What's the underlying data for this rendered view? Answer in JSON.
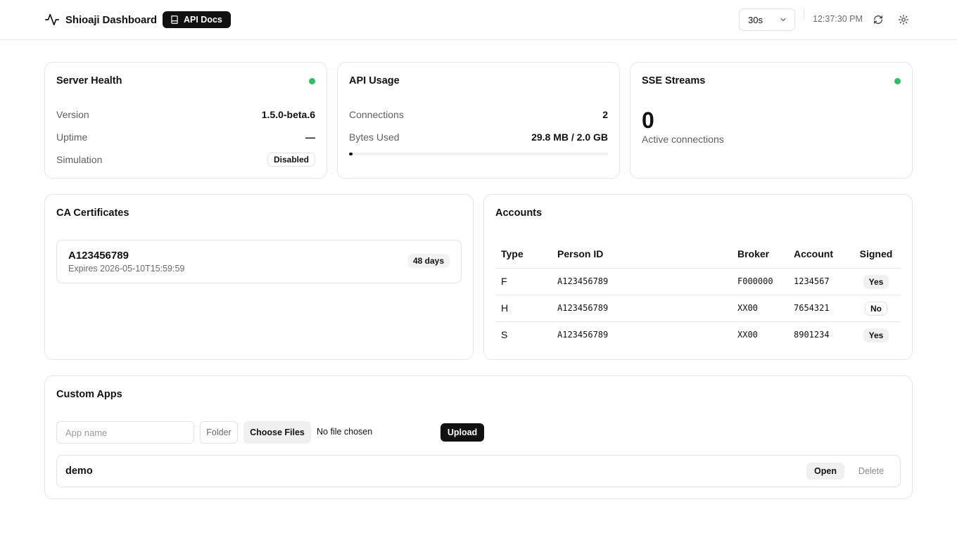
{
  "header": {
    "title": "Shioaji Dashboard",
    "docs_label": "API Docs",
    "refresh_interval": "30s",
    "clock": "12:37:30 PM",
    "logo_icon": "activity-pulse-icon",
    "docs_icon": "book-icon",
    "refresh_icon": "refresh-icon",
    "theme_icon": "sun-icon"
  },
  "server_health": {
    "title": "Server Health",
    "status_color": "#22c55e",
    "rows": [
      {
        "label": "Version",
        "value": "1.5.0-beta.6"
      },
      {
        "label": "Uptime",
        "value": "—"
      },
      {
        "label": "Simulation",
        "value": "Disabled"
      }
    ]
  },
  "api_usage": {
    "title": "API Usage",
    "connections_label": "Connections",
    "connections": "2",
    "bytes_label": "Bytes Used",
    "bytes": "29.8 MB / 2.0 GB",
    "bytes_fraction": 0.0146
  },
  "sse": {
    "title": "SSE Streams",
    "status_color": "#22c55e",
    "count": "0",
    "sub": "Active connections"
  },
  "ca": {
    "title": "CA Certificates",
    "certs": [
      {
        "id": "A123456789",
        "expires": "Expires 2026-05-10T15:59:59",
        "days": "48 days"
      }
    ]
  },
  "accounts": {
    "title": "Accounts",
    "columns": [
      "Type",
      "Person ID",
      "Broker",
      "Account",
      "Signed"
    ],
    "rows": [
      {
        "type": "F",
        "person_id": "A123456789",
        "broker": "F000000",
        "account": "1234567",
        "signed": "Yes"
      },
      {
        "type": "H",
        "person_id": "A123456789",
        "broker": "XX00",
        "account": "7654321",
        "signed": "No"
      },
      {
        "type": "S",
        "person_id": "A123456789",
        "broker": "XX00",
        "account": "8901234",
        "signed": "Yes"
      }
    ]
  },
  "custom_apps": {
    "title": "Custom Apps",
    "name_placeholder": "App name",
    "folder_label": "Folder",
    "choose_label": "Choose Files",
    "no_file": "No file chosen",
    "upload_label": "Upload",
    "apps": [
      {
        "name": "demo",
        "open_label": "Open",
        "delete_label": "Delete"
      }
    ]
  }
}
